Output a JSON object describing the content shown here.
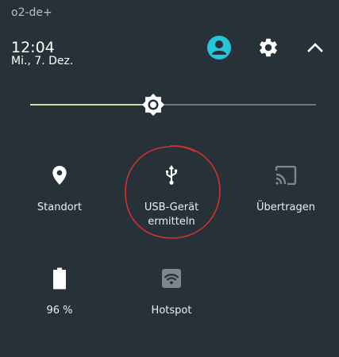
{
  "status_bar": {
    "carrier": "o2-de+"
  },
  "header": {
    "time": "12:04",
    "date": "Mi., 7. Dez.",
    "icons": [
      "account-icon",
      "gear-icon",
      "chevron-up-icon"
    ]
  },
  "brightness": {
    "level": 0.43
  },
  "tiles": {
    "standort": {
      "label": "Standort",
      "icon": "location-pin-icon",
      "active": true
    },
    "usb": {
      "label_line1": "USB-Gerät",
      "label_line2": "ermitteln",
      "icon": "usb-icon",
      "active": true
    },
    "ubertragen": {
      "label": "Übertragen",
      "icon": "cast-icon",
      "active": false
    },
    "battery": {
      "label": "96 %",
      "icon": "battery-icon",
      "level": 0.96
    },
    "hotspot": {
      "label": "Hotspot",
      "icon": "wifi-hotspot-icon",
      "active": false
    }
  },
  "colors": {
    "background": "#263238",
    "accent": "#26c6da",
    "slider_fill": "#c5e1a5",
    "annotation": "#d32f2f"
  }
}
